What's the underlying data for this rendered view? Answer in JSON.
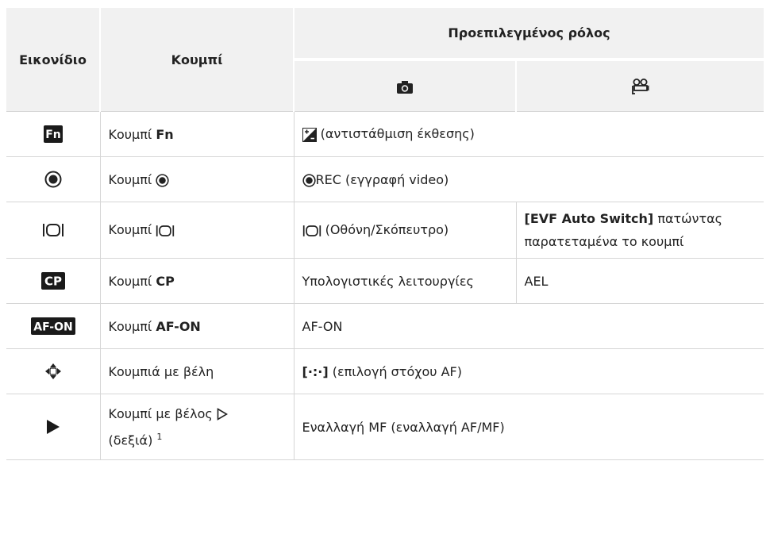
{
  "header": {
    "icon": "Εικονίδιο",
    "button": "Κουμπί",
    "default_role": "Προεπιλεγμένος ρόλος",
    "photo_icon": "camera-icon",
    "video_icon": "movie-camera-icon"
  },
  "rows": [
    {
      "icon": "fn-icon",
      "button_prefix": "Κουμπί ",
      "button_bold": "Fn",
      "role_icon": "exposure-compensation-icon",
      "photo": " (αντιστάθμιση έκθεσης)",
      "video": ""
    },
    {
      "icon": "record-icon",
      "button_prefix": "Κουμπί ",
      "button_icon": "record-icon",
      "role_icon": "record-icon",
      "photo": "REC (εγγραφή video)",
      "video": ""
    },
    {
      "icon": "monitor-evf-icon",
      "button_prefix": "Κουμπί ",
      "button_icon": "monitor-evf-icon",
      "role_icon": "monitor-evf-icon",
      "photo": " (Οθόνη/Σκόπευτρο)",
      "video_bold": "[EVF Auto Switch]",
      "video": " πατώντας παρατεταμένα το κουμπί"
    },
    {
      "icon": "cp-icon",
      "button_prefix": "Κουμπί ",
      "button_bold": "CP",
      "photo": "Υπολογιστικές λειτουργίες",
      "video": "AEL"
    },
    {
      "icon": "af-on-icon",
      "button_prefix": "Κουμπί ",
      "button_bold": "AF-ON",
      "photo": "AF-ON",
      "video": ""
    },
    {
      "icon": "arrow-pad-icon",
      "button_text": "Κουμπιά με βέλη",
      "role_icon": "af-target-icon",
      "photo": " (επιλογή στόχου AF)",
      "video": ""
    },
    {
      "icon": "play-icon",
      "button_line1": "Κουμπί με βέλος ",
      "button_icon": "right-triangle-icon",
      "button_line2": "(δεξιά) ",
      "button_sup": "1",
      "photo": "Εναλλαγή MF (εναλλαγή AF/MF)",
      "video": ""
    }
  ],
  "af_target_glyph": "[·:·]"
}
